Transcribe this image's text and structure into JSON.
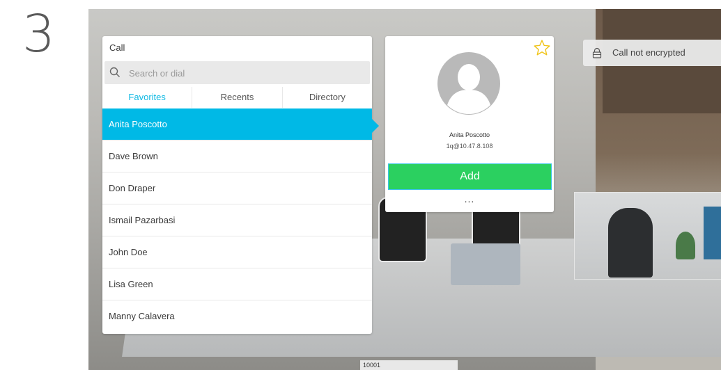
{
  "step": {
    "number": "3"
  },
  "call_panel": {
    "title": "Call",
    "search": {
      "placeholder": "Search or dial",
      "value": ""
    },
    "tabs": [
      {
        "label": "Favorites",
        "active": true
      },
      {
        "label": "Recents",
        "active": false
      },
      {
        "label": "Directory",
        "active": false
      }
    ],
    "contacts": [
      {
        "name": "Anita Poscotto",
        "selected": true
      },
      {
        "name": "Dave Brown"
      },
      {
        "name": "Don Draper"
      },
      {
        "name": "Ismail Pazarbasi"
      },
      {
        "name": "John Doe"
      },
      {
        "name": "Lisa Green"
      },
      {
        "name": "Manny Calavera"
      }
    ]
  },
  "contact_card": {
    "name": "Anita Poscotto",
    "address": "1q@10.47.8.108",
    "add_label": "Add",
    "more_label": "...",
    "favorite_icon": "star-icon",
    "avatar_icon": "person-silhouette-icon"
  },
  "encryption": {
    "text": "Call not encrypted",
    "icon": "lock-icon"
  },
  "bottom_label": "10001",
  "colors": {
    "accent": "#00b9e6",
    "add_button": "#2bd060",
    "star": "#f0c419"
  }
}
